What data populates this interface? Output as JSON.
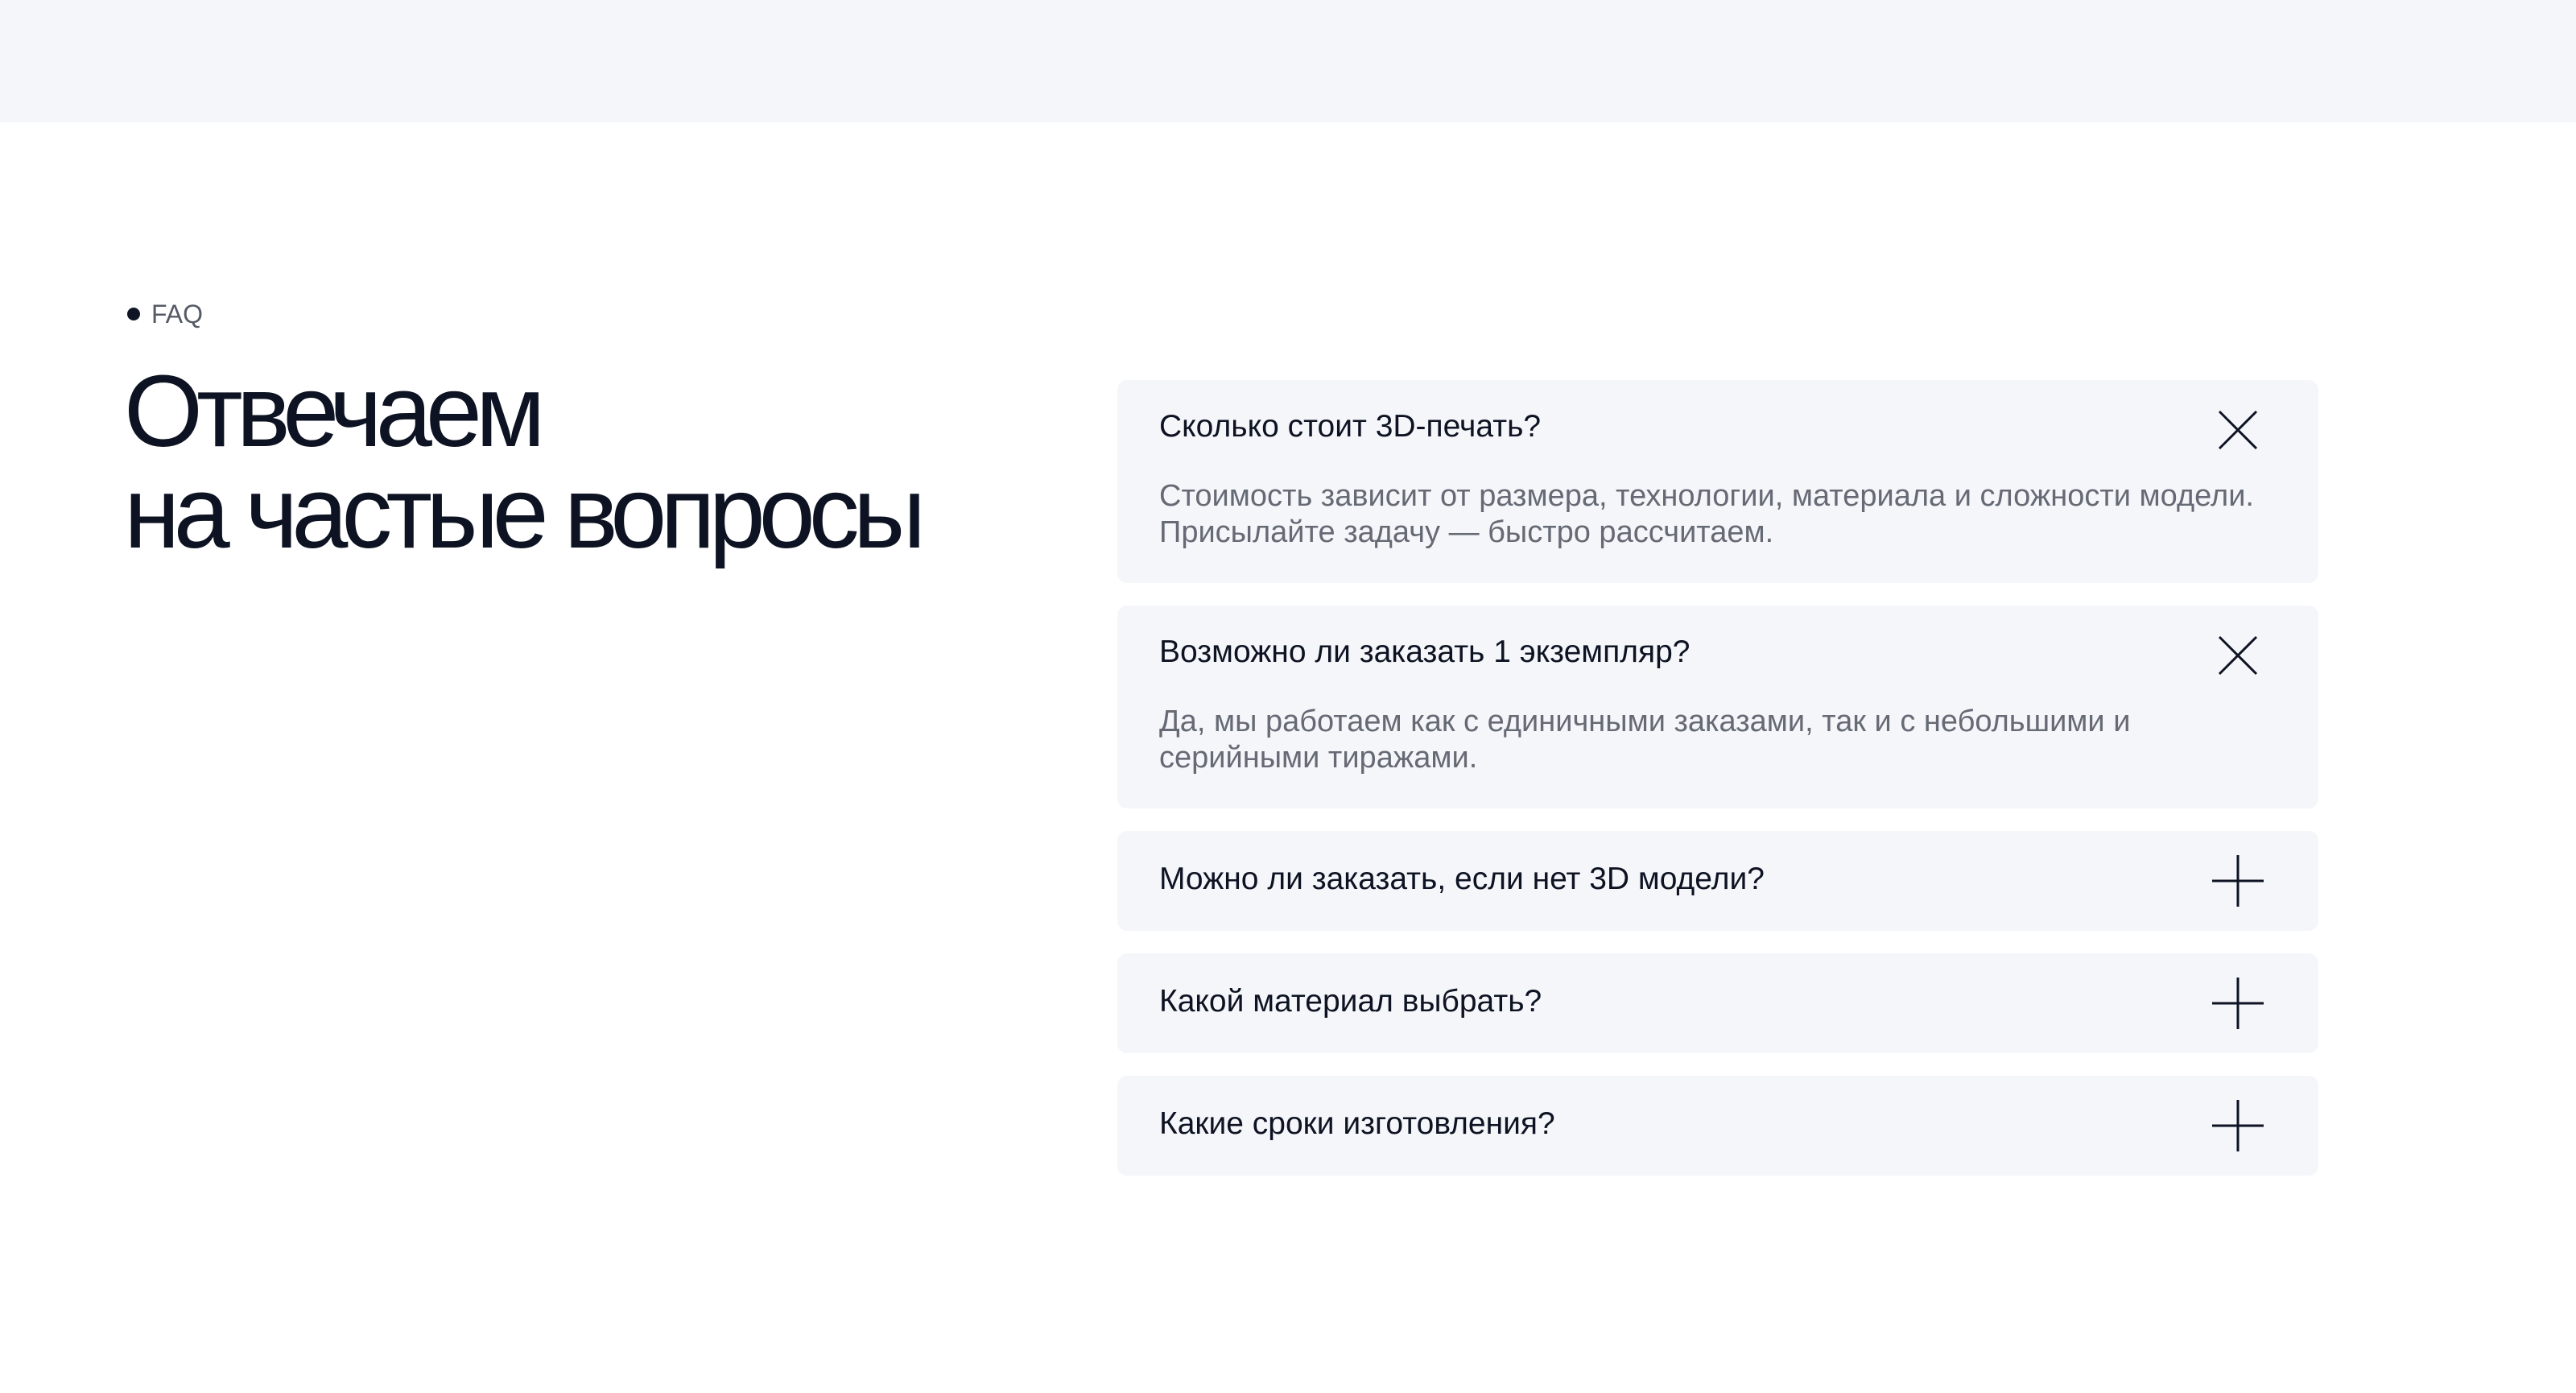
{
  "section": {
    "tag": "FAQ",
    "title_line1": "Отвечаем",
    "title_line2": "на частые вопросы"
  },
  "faq": {
    "items": [
      {
        "question": "Сколько стоит 3D-печать?",
        "answer": "Стоимость зависит от размера, технологии, материала и сложности модели. Присылайте задачу — быстро рассчитаем.",
        "expanded": true,
        "icon": "close-icon"
      },
      {
        "question": "Возможно ли заказать 1 экземпляр?",
        "answer": "Да, мы работаем как с единичными заказами, так и с небольшими и серийными тиражами.",
        "expanded": true,
        "icon": "close-icon"
      },
      {
        "question": "Можно ли заказать, если нет 3D модели?",
        "expanded": false,
        "icon": "plus-icon"
      },
      {
        "question": "Какой материал выбрать?",
        "expanded": false,
        "icon": "plus-icon"
      },
      {
        "question": "Какие сроки изготовления?",
        "expanded": false,
        "icon": "plus-icon"
      }
    ]
  },
  "colors": {
    "panel_background": "#f5f6fa",
    "heading": "#0d1322",
    "answer_text": "#656a74"
  }
}
